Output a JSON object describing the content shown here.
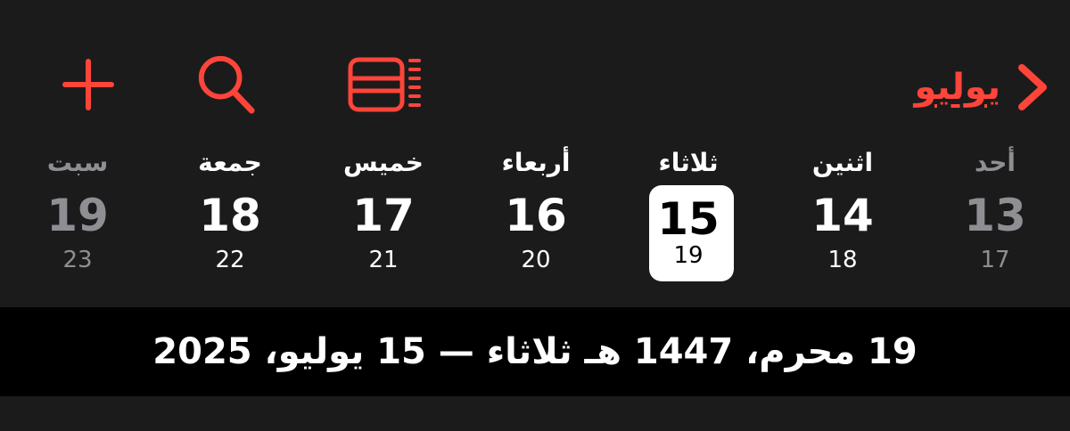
{
  "colors": {
    "accent": "#ff453a",
    "background": "#1c1b1c",
    "banner_background": "#000000",
    "weekend_text": "#8e8e93",
    "selected_bg": "#ffffff"
  },
  "toolbar": {
    "back_label": "يوليو",
    "back_icon": "chevron-right-icon",
    "view_icon": "list-view-icon",
    "search_icon": "search-icon",
    "add_icon": "plus-icon"
  },
  "week": {
    "days": [
      {
        "name": "أحد",
        "number": "13",
        "hijri": "17"
      },
      {
        "name": "اثنين",
        "number": "14",
        "hijri": "18"
      },
      {
        "name": "ثلاثاء",
        "number": "15",
        "hijri": "19"
      },
      {
        "name": "أربعاء",
        "number": "16",
        "hijri": "20"
      },
      {
        "name": "خميس",
        "number": "17",
        "hijri": "21"
      },
      {
        "name": "جمعة",
        "number": "18",
        "hijri": "22"
      },
      {
        "name": "سبت",
        "number": "19",
        "hijri": "23"
      }
    ],
    "selected_day": "15"
  },
  "banner": {
    "text": "19 محرم، 1447 هـ  ثلاثاء — 15 يوليو، 2025"
  }
}
